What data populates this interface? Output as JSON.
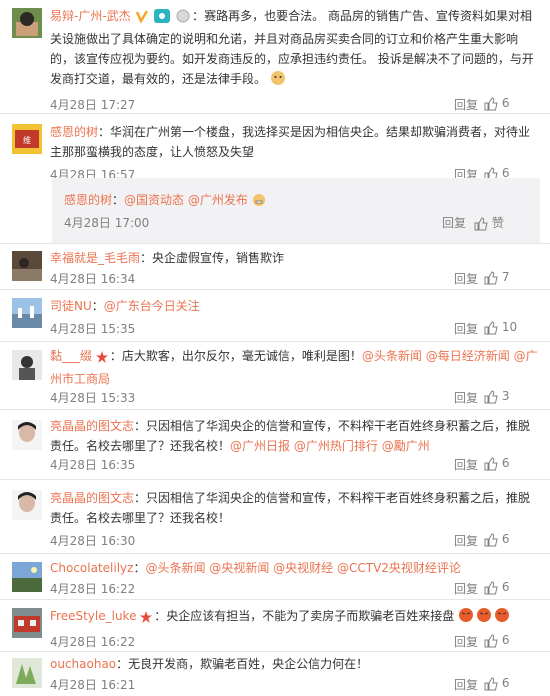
{
  "comments": [
    {
      "user": "易辩-广州-武杰",
      "colon": "：",
      "text": "赛路再多，也要合法。 商品房的销售广告、宣传资料如果对相关设施做出了具体确定的说明和允诺，并且对商品房买卖合同的订立和价格产生重大影响的，该宣传应视为要约。如开发商违反的，应承担违约责任。 投诉是解决不了问题的，与开发商打交道，最有效的，还是法律手段。",
      "time": "4月28日 17:27",
      "reply": "回复",
      "likes": "6"
    },
    {
      "user": "感恩的树",
      "colon": "：",
      "text": "华润在广州第一个楼盘，我选择买是因为相信央企。结果却欺骗消费者，对待业主那那蛮横我的态度，让人愤怒及失望",
      "time": "4月28日 16:57",
      "reply": "回复",
      "likes": "6",
      "sub": {
        "user": "感恩的树",
        "colon": "：",
        "links": [
          "@国资动态",
          "@广州发布"
        ],
        "time": "4月28日 17:00",
        "reply": "回复",
        "likes": "赞"
      }
    },
    {
      "user": "幸福就是_毛毛雨",
      "colon": "：",
      "text": "央企虚假宣传，销售欺诈",
      "time": "4月28日 16:34",
      "reply": "回复",
      "likes": "7"
    },
    {
      "user": "司徒NU",
      "colon": "：",
      "links": [
        "@广东台今日关注"
      ],
      "time": "4月28日 15:35",
      "reply": "回复",
      "likes": "10"
    },
    {
      "user": "黏___缀",
      "colon": "：",
      "text": "店大欺客，出尔反尔，毫无诚信，唯利是图！",
      "links": [
        "@头条新闻",
        "@每日经济新闻",
        "@广州市工商局"
      ],
      "time": "4月28日 15:33",
      "reply": "回复",
      "likes": "3"
    },
    {
      "user": "亮晶晶的图文志",
      "colon": "：",
      "text": "只因相信了华润央企的信誉和宣传，不料榨干老百姓终身积蓄之后，推脱责任。名校去哪里了？还我名校！",
      "links": [
        "@广州日报",
        "@广州热门排行",
        "@勵广州"
      ],
      "time": "4月28日 16:35",
      "reply": "回复",
      "likes": "6"
    },
    {
      "user": "亮晶晶的图文志",
      "colon": "：",
      "text": "只因相信了华润央企的信誉和宣传，不料榨干老百姓终身积蓄之后，推脱责任。名校去哪里了？还我名校！",
      "time": "4月28日 16:30",
      "reply": "回复",
      "likes": "6"
    },
    {
      "user": "Chocolatelilyz",
      "colon": "：",
      "links": [
        "@头条新闻",
        "@央视新闻",
        "@央视财经",
        "@CCTV2央视财经评论"
      ],
      "time": "4月28日 16:22",
      "reply": "回复",
      "likes": "6"
    },
    {
      "user": "FreeStyle_luke",
      "colon": "：",
      "text": "央企应该有担当，不能为了卖房子而欺骗老百姓来接盘",
      "time": "4月28日 16:22",
      "reply": "回复",
      "likes": "6"
    },
    {
      "user": "ouchaohao",
      "colon": "：",
      "text": "无良开发商，欺骗老百姓，央企公信力何在！",
      "time": "4月28日 16:21",
      "reply": "回复",
      "likes": "6"
    }
  ],
  "colors": {
    "name": "#eb7350",
    "meta": "#808080",
    "sub_bg": "#f2f2f5"
  }
}
